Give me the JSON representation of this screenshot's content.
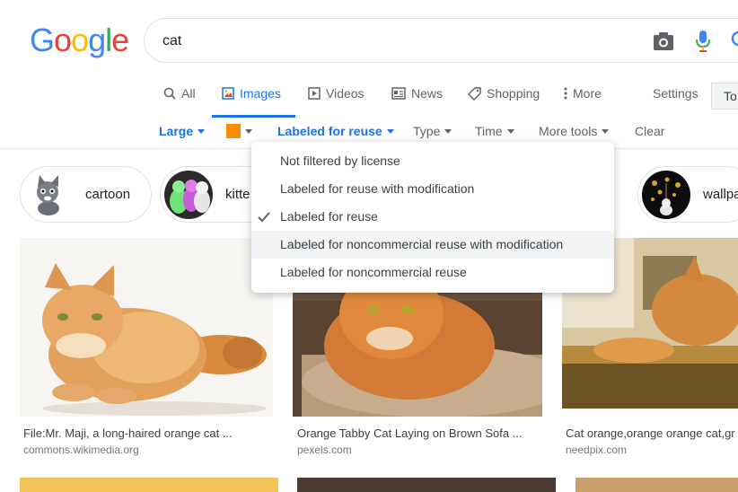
{
  "logo": [
    "G",
    "o",
    "o",
    "g",
    "l",
    "e"
  ],
  "logo_colors": [
    "#4285f4",
    "#ea4335",
    "#fbbc05",
    "#4285f4",
    "#34a853",
    "#ea4335"
  ],
  "search": {
    "query": "cat"
  },
  "tabs": [
    {
      "label": "All",
      "icon": "search-icon"
    },
    {
      "label": "Images",
      "icon": "image-icon",
      "active": true
    },
    {
      "label": "Videos",
      "icon": "play-icon"
    },
    {
      "label": "News",
      "icon": "news-icon"
    },
    {
      "label": "Shopping",
      "icon": "tag-icon"
    },
    {
      "label": "More",
      "icon": "more-vert-icon"
    }
  ],
  "settings_label": "Settings",
  "tools_label": "To",
  "filters": {
    "size": "Large",
    "color_swatch": "#fb8c00",
    "usage": "Labeled for reuse",
    "type": "Type",
    "time": "Time",
    "more_tools": "More tools",
    "clear": "Clear"
  },
  "chips": [
    {
      "label": "cartoon"
    },
    {
      "label": "kitte"
    },
    {
      "label": "wallpa"
    }
  ],
  "dropdown": {
    "options": [
      {
        "label": "Not filtered by license"
      },
      {
        "label": "Labeled for reuse with modification"
      },
      {
        "label": "Labeled for reuse",
        "checked": true
      },
      {
        "label": "Labeled for noncommercial reuse with modification",
        "hover": true
      },
      {
        "label": "Labeled for noncommercial reuse"
      }
    ]
  },
  "results": [
    {
      "title": "File:Mr. Maji, a long-haired orange cat ...",
      "source": "commons.wikimedia.org"
    },
    {
      "title": "Orange Tabby Cat Laying on Brown Sofa ...",
      "source": "pexels.com"
    },
    {
      "title": "Cat orange,orange orange cat,gr",
      "source": "needpix.com"
    }
  ]
}
